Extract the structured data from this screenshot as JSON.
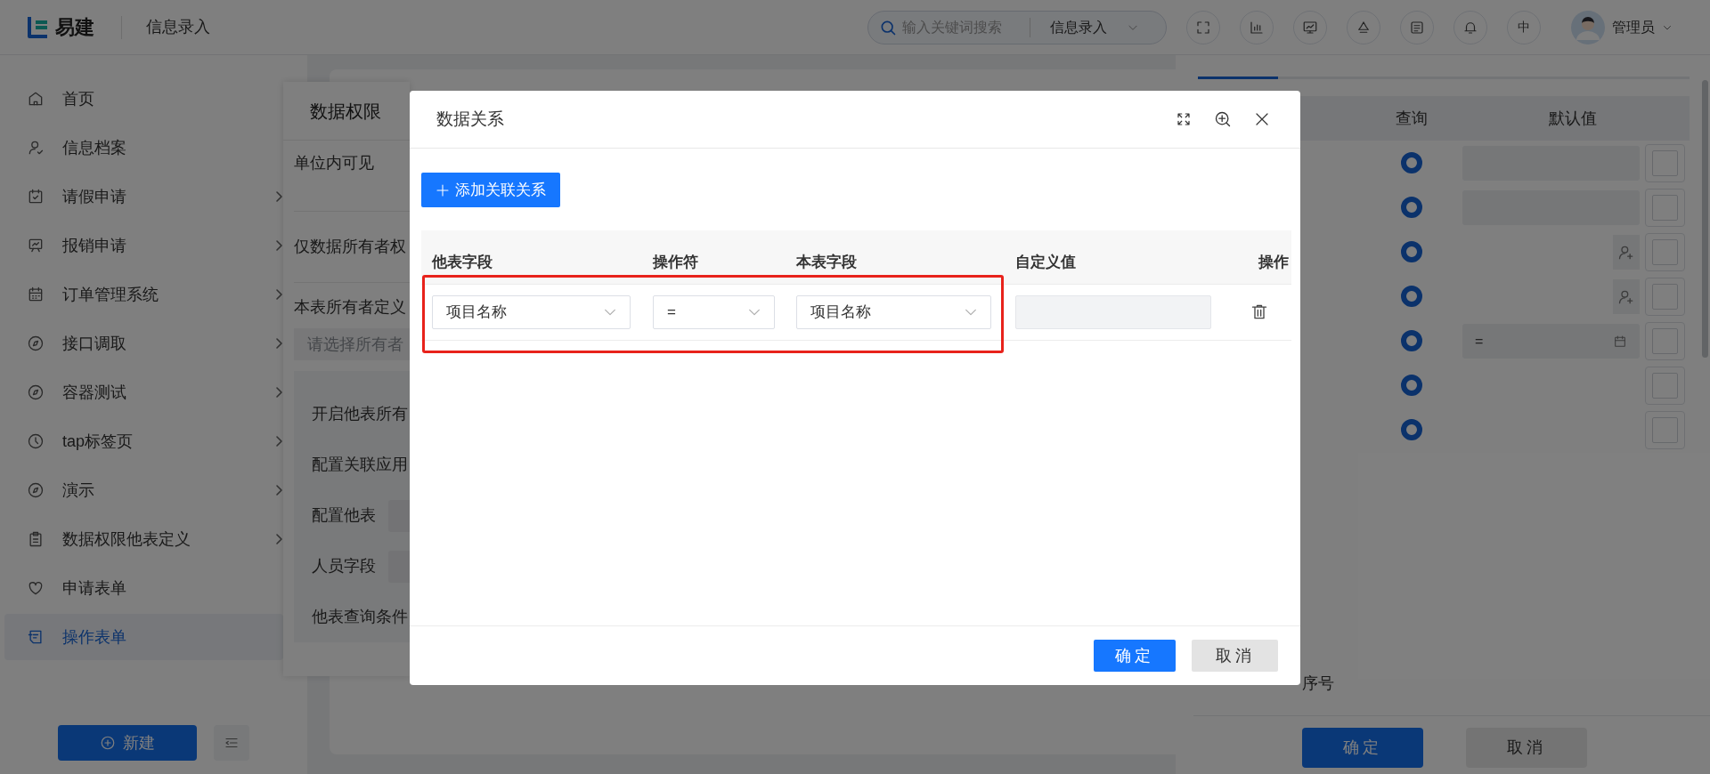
{
  "header": {
    "logo_text": "易建",
    "page_title": "信息录入",
    "search": {
      "placeholder": "输入关键词搜索",
      "scope": "信息录入"
    },
    "language": "中",
    "user": "管理员"
  },
  "sidebar": {
    "items": [
      {
        "label": "首页",
        "selected": false,
        "has_children": false
      },
      {
        "label": "信息档案",
        "selected": false,
        "has_children": false
      },
      {
        "label": "请假申请",
        "selected": false,
        "has_children": true
      },
      {
        "label": "报销申请",
        "selected": false,
        "has_children": true
      },
      {
        "label": "订单管理系统",
        "selected": false,
        "has_children": true
      },
      {
        "label": "接口调取",
        "selected": false,
        "has_children": true
      },
      {
        "label": "容器测试",
        "selected": false,
        "has_children": true
      },
      {
        "label": "tap标签页",
        "selected": false,
        "has_children": true
      },
      {
        "label": "演示",
        "selected": false,
        "has_children": true
      },
      {
        "label": "数据权限他表定义",
        "selected": false,
        "has_children": true
      },
      {
        "label": "申请表单",
        "selected": false,
        "has_children": false
      },
      {
        "label": "操作表单",
        "selected": true,
        "has_children": false
      }
    ],
    "new_button": "新建"
  },
  "permission_panel": {
    "title": "数据权限",
    "options": [
      "单位内可见",
      "仅数据所有者权"
    ],
    "owner_label": "本表所有者定义",
    "owner_placeholder": "请选择所有者",
    "settings": [
      {
        "label": "开启他表所有",
        "kind": "text"
      },
      {
        "label": "配置关联应用",
        "kind": "text"
      },
      {
        "label": "配置他表",
        "kind": "field"
      },
      {
        "label": "人员字段",
        "kind": "field"
      },
      {
        "label": "他表查询条件",
        "kind": "text"
      }
    ]
  },
  "drawer": {
    "columns": [
      "查询",
      "默认值"
    ],
    "rows": [
      {
        "query_selected": true,
        "kind": "input",
        "checked": false
      },
      {
        "query_selected": true,
        "kind": "input",
        "checked": false
      },
      {
        "query_selected": true,
        "kind": "person",
        "checked": false
      },
      {
        "query_selected": true,
        "kind": "person",
        "checked": false
      },
      {
        "query_selected": true,
        "kind": "date",
        "default_value": "=",
        "checked": false
      },
      {
        "query_selected": true,
        "kind": "none",
        "checked": false
      },
      {
        "query_selected": true,
        "kind": "none",
        "checked": false
      }
    ],
    "footer_text": "序号",
    "buttons": [
      {
        "label": "确定",
        "kind": "primary"
      },
      {
        "label": "取消",
        "kind": "secondary"
      }
    ]
  },
  "modal": {
    "title": "数据关系",
    "add_button": "添加关联关系",
    "columns": [
      "他表字段",
      "操作符",
      "本表字段",
      "自定义值",
      "操作"
    ],
    "rows": [
      {
        "other_field": "项目名称",
        "operator": "=",
        "this_field": "项目名称",
        "highlighted": true
      }
    ],
    "buttons": [
      {
        "label": "确定",
        "kind": "primary"
      },
      {
        "label": "取消",
        "kind": "secondary"
      }
    ]
  }
}
